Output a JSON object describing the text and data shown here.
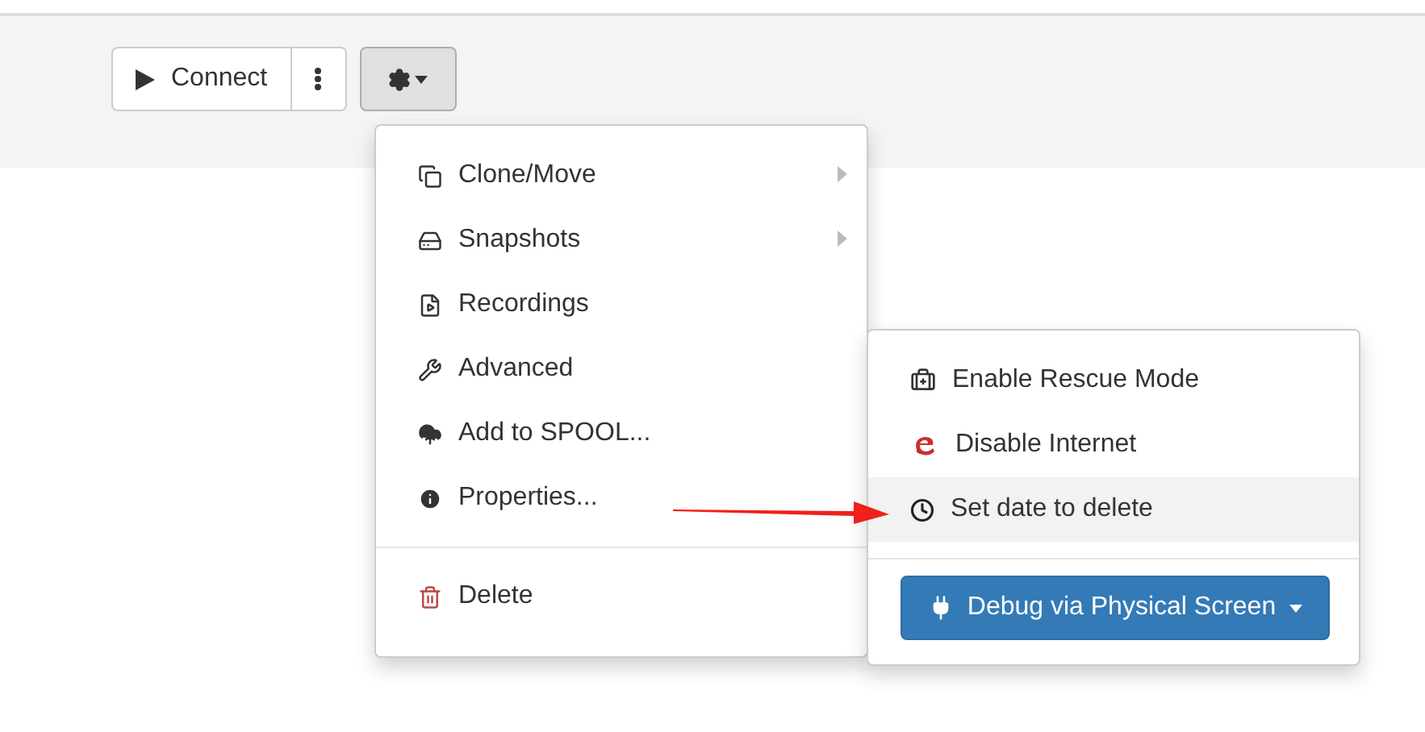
{
  "toolbar": {
    "connect_label": "Connect"
  },
  "actions_menu": {
    "items": [
      {
        "label": "Clone/Move",
        "submenu": true,
        "kind": "normal"
      },
      {
        "label": "Snapshots",
        "submenu": true,
        "kind": "normal"
      },
      {
        "label": "Recordings",
        "submenu": false,
        "kind": "normal"
      },
      {
        "label": "Advanced",
        "submenu": false,
        "kind": "normal"
      },
      {
        "label": "Add to SPOOL...",
        "submenu": false,
        "kind": "normal"
      },
      {
        "label": "Properties...",
        "submenu": false,
        "kind": "normal"
      },
      {
        "label": "Delete",
        "submenu": false,
        "kind": "danger"
      }
    ]
  },
  "advanced_menu": {
    "items": [
      {
        "label": "Enable Rescue Mode",
        "selected": false
      },
      {
        "label": "Disable Internet",
        "selected": false
      },
      {
        "label": "Set date to delete",
        "selected": true
      }
    ],
    "button": "Debug via Physical Screen"
  }
}
